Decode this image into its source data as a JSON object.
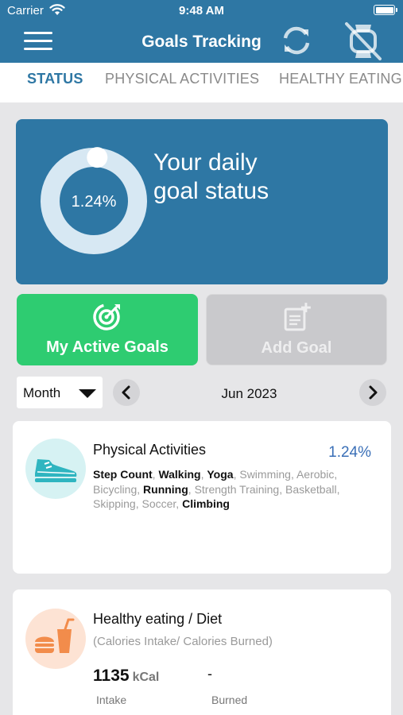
{
  "status_bar": {
    "carrier": "Carrier",
    "time": "9:48 AM"
  },
  "header": {
    "title": "Goals Tracking"
  },
  "tabs": [
    {
      "label": "STATUS",
      "active": true
    },
    {
      "label": "PHYSICAL ACTIVITIES",
      "active": false
    },
    {
      "label": "HEALTHY EATING",
      "active": false
    }
  ],
  "status_card": {
    "percent_label": "1.24%",
    "progress_fraction": 0.0124,
    "heading_line1": "Your daily",
    "heading_line2": "goal status"
  },
  "buttons": {
    "active_goals": "My Active Goals",
    "add_goal": "Add Goal"
  },
  "period": {
    "range": "Month",
    "current": "Jun 2023"
  },
  "physical_card": {
    "title": "Physical Activities",
    "percent": "1.24%",
    "activities": [
      {
        "name": "Step Count",
        "active": true
      },
      {
        "name": "Walking",
        "active": true
      },
      {
        "name": "Yoga",
        "active": true
      },
      {
        "name": "Swimming",
        "active": false
      },
      {
        "name": "Aerobic",
        "active": false
      },
      {
        "name": "Bicycling",
        "active": false
      },
      {
        "name": "Running",
        "active": true
      },
      {
        "name": "Strength Training",
        "active": false
      },
      {
        "name": "Basketball",
        "active": false
      },
      {
        "name": "Skipping",
        "active": false
      },
      {
        "name": "Soccer",
        "active": false
      },
      {
        "name": "Climbing",
        "active": true
      }
    ]
  },
  "eating_card": {
    "title": "Healthy eating / Diet",
    "subtitle": "(Calories Intake/ Calories Burned)",
    "intake_value": "1135",
    "intake_unit": "kCal",
    "burned_value": "-",
    "intake_label": "Intake",
    "burned_label": "Burned"
  },
  "colors": {
    "primary": "#2e77a4",
    "green": "#2ecc71",
    "disabled": "#c9c9cc",
    "percent_blue": "#3a6fb7",
    "shoe": "#2fb5c0",
    "food": "#f28c4b"
  }
}
